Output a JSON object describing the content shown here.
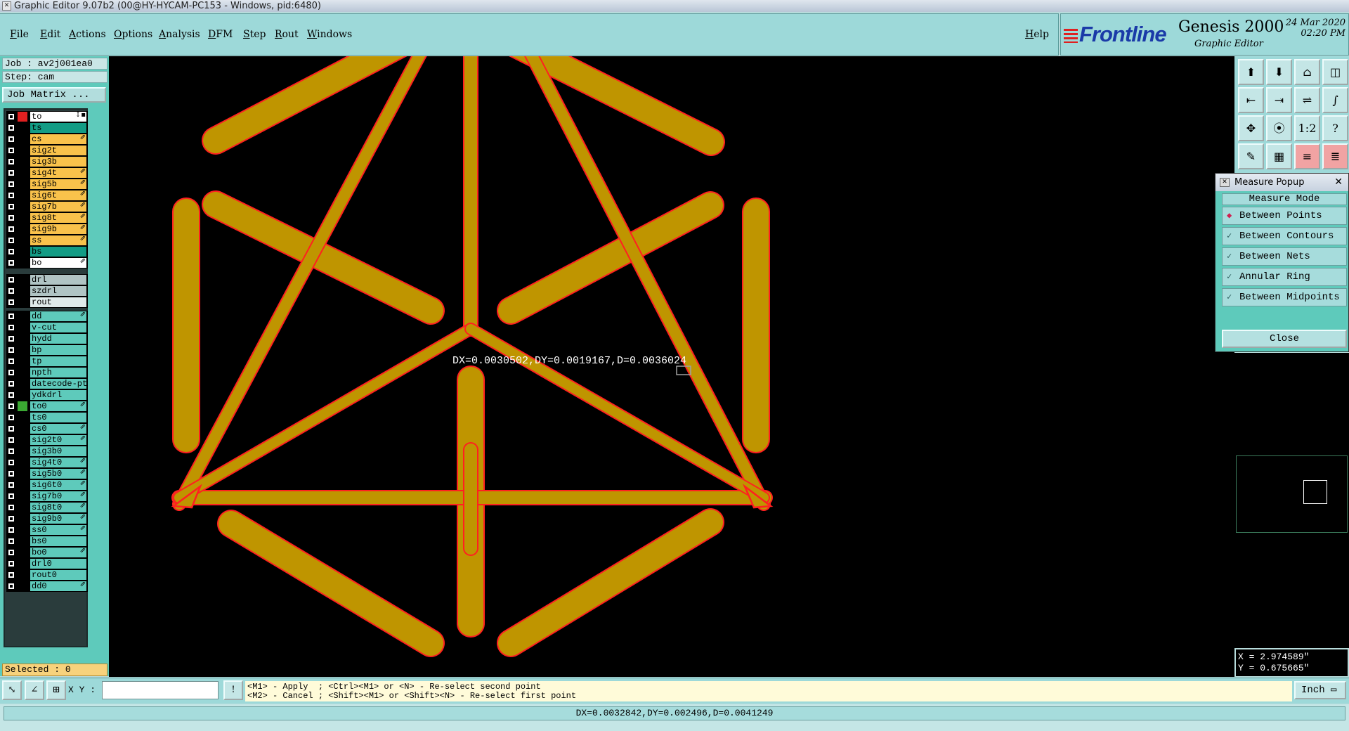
{
  "window": {
    "title": "Graphic Editor 9.07b2 (00@HY-HYCAM-PC153 - Windows, pid:6480)"
  },
  "menubar": {
    "items": [
      "File",
      "Edit",
      "Actions",
      "Options",
      "Analysis",
      "DFM",
      "Step",
      "Rout",
      "Windows"
    ],
    "help": "Help"
  },
  "brand": {
    "logo": "Frontline",
    "product": "Genesis 2000",
    "subtitle": "Graphic Editor",
    "date": "24 Mar 2020",
    "time": "02:20 PM"
  },
  "leftpanel": {
    "job": "Job : av2j001ea0",
    "step": "Step: cam",
    "job_matrix": "Job Matrix ...",
    "selected": "Selected : 0"
  },
  "layers": {
    "group1": [
      {
        "name": "to",
        "color": "#ffffff",
        "swatch": "#e02020",
        "mark": "↕▪"
      },
      {
        "name": "ts",
        "color": "#139c85",
        "swatch": "#000000",
        "mark": ""
      },
      {
        "name": "cs",
        "color": "#f9c24b",
        "swatch": "#000000",
        "mark": "⇗"
      },
      {
        "name": "sig2t",
        "color": "#f9c24b",
        "swatch": "#000000",
        "mark": ""
      },
      {
        "name": "sig3b",
        "color": "#f9c24b",
        "swatch": "#000000",
        "mark": ""
      },
      {
        "name": "sig4t",
        "color": "#f9c24b",
        "swatch": "#000000",
        "mark": "⇗"
      },
      {
        "name": "sig5b",
        "color": "#f9c24b",
        "swatch": "#000000",
        "mark": "⇗"
      },
      {
        "name": "sig6t",
        "color": "#f9c24b",
        "swatch": "#000000",
        "mark": "⇗"
      },
      {
        "name": "sig7b",
        "color": "#f9c24b",
        "swatch": "#000000",
        "mark": "⇗"
      },
      {
        "name": "sig8t",
        "color": "#f9c24b",
        "swatch": "#000000",
        "mark": "⇗"
      },
      {
        "name": "sig9b",
        "color": "#f9c24b",
        "swatch": "#000000",
        "mark": "⇗"
      },
      {
        "name": "ss",
        "color": "#f9c24b",
        "swatch": "#000000",
        "mark": "⇗"
      },
      {
        "name": "bs",
        "color": "#139c85",
        "swatch": "#000000",
        "mark": ""
      },
      {
        "name": "bo",
        "color": "#ffffff",
        "swatch": "#000000",
        "mark": "⇗"
      }
    ],
    "group2": [
      {
        "name": "drl",
        "color": "#b0c4c4",
        "swatch": "#000000",
        "mark": ""
      },
      {
        "name": "szdrl",
        "color": "#b0c4c4",
        "swatch": "#000000",
        "mark": ""
      },
      {
        "name": "rout",
        "color": "#e0eaea",
        "swatch": "#000000",
        "mark": ""
      }
    ],
    "group3": [
      {
        "name": "dd",
        "color": "#5ecabb",
        "swatch": "#000000",
        "mark": "⇗"
      },
      {
        "name": "v-cut",
        "color": "#5ecabb",
        "swatch": "#000000",
        "mark": ""
      },
      {
        "name": "hydd",
        "color": "#5ecabb",
        "swatch": "#000000",
        "mark": ""
      },
      {
        "name": "bp",
        "color": "#5ecabb",
        "swatch": "#000000",
        "mark": ""
      },
      {
        "name": "tp",
        "color": "#5ecabb",
        "swatch": "#000000",
        "mark": ""
      },
      {
        "name": "npth",
        "color": "#5ecabb",
        "swatch": "#000000",
        "mark": ""
      },
      {
        "name": "datecode-pt",
        "color": "#5ecabb",
        "swatch": "#000000",
        "mark": ""
      },
      {
        "name": "ydkdrl",
        "color": "#5ecabb",
        "swatch": "#000000",
        "mark": ""
      },
      {
        "name": "to0",
        "color": "#5ecabb",
        "swatch": "#3aa832",
        "mark": "⇗"
      },
      {
        "name": "ts0",
        "color": "#5ecabb",
        "swatch": "#000000",
        "mark": ""
      },
      {
        "name": "cs0",
        "color": "#5ecabb",
        "swatch": "#000000",
        "mark": "⇗"
      },
      {
        "name": "sig2t0",
        "color": "#5ecabb",
        "swatch": "#000000",
        "mark": "⇗"
      },
      {
        "name": "sig3b0",
        "color": "#5ecabb",
        "swatch": "#000000",
        "mark": ""
      },
      {
        "name": "sig4t0",
        "color": "#5ecabb",
        "swatch": "#000000",
        "mark": "⇗"
      },
      {
        "name": "sig5b0",
        "color": "#5ecabb",
        "swatch": "#000000",
        "mark": "⇗"
      },
      {
        "name": "sig6t0",
        "color": "#5ecabb",
        "swatch": "#000000",
        "mark": "⇗"
      },
      {
        "name": "sig7b0",
        "color": "#5ecabb",
        "swatch": "#000000",
        "mark": "⇗"
      },
      {
        "name": "sig8t0",
        "color": "#5ecabb",
        "swatch": "#000000",
        "mark": "⇗"
      },
      {
        "name": "sig9b0",
        "color": "#5ecabb",
        "swatch": "#000000",
        "mark": "⇗"
      },
      {
        "name": "ss0",
        "color": "#5ecabb",
        "swatch": "#000000",
        "mark": "⇗"
      },
      {
        "name": "bs0",
        "color": "#5ecabb",
        "swatch": "#000000",
        "mark": ""
      },
      {
        "name": "bo0",
        "color": "#5ecabb",
        "swatch": "#000000",
        "mark": "⇗"
      },
      {
        "name": "drl0",
        "color": "#5ecabb",
        "swatch": "#000000",
        "mark": ""
      },
      {
        "name": "rout0",
        "color": "#5ecabb",
        "swatch": "#000000",
        "mark": ""
      },
      {
        "name": "dd0",
        "color": "#5ecabb",
        "swatch": "#000000",
        "mark": "⇗"
      }
    ]
  },
  "canvas": {
    "measure_label": "DX=0.0030502,DY=0.0019167,D=0.0036024",
    "fill_color": "#bf9500",
    "outline_color": "#ff2020"
  },
  "toolbar": {
    "buttons": [
      {
        "name": "snap-up-icon",
        "glyph": "⬆"
      },
      {
        "name": "snap-down-icon",
        "glyph": "⬇"
      },
      {
        "name": "home-icon",
        "glyph": "⌂"
      },
      {
        "name": "window-icon",
        "glyph": "◫"
      },
      {
        "name": "left-icon",
        "glyph": "⇤"
      },
      {
        "name": "right-icon",
        "glyph": "⇥"
      },
      {
        "name": "mirror-icon",
        "glyph": "⇌"
      },
      {
        "name": "s-curve-icon",
        "glyph": "∫"
      },
      {
        "name": "fit-icon",
        "glyph": "✥"
      },
      {
        "name": "zoom-icon",
        "glyph": "⦿"
      },
      {
        "name": "scale-icon",
        "glyph": "1:2"
      },
      {
        "name": "help-icon",
        "glyph": "?"
      },
      {
        "name": "pen-icon",
        "glyph": "✎"
      },
      {
        "name": "grid-icon",
        "glyph": "▦"
      },
      {
        "name": "layer-a-icon",
        "glyph": "≡"
      },
      {
        "name": "layer-b-icon",
        "glyph": "≣"
      }
    ]
  },
  "popup": {
    "title": "Measure Popup",
    "mode_header": "Measure Mode",
    "items": [
      "Between Points",
      "Between Contours",
      "Between Nets",
      "Annular Ring",
      "Between Midpoints"
    ],
    "close": "Close"
  },
  "coords": {
    "x": "X = 2.974589\"",
    "y": "Y = 0.675665\""
  },
  "bottombar": {
    "xy_label": "X Y :",
    "xy_value": "",
    "hint_line1": "<M1> - Apply  ; <Ctrl><M1> or <N> - Re-select second point",
    "hint_line2": "<M2> - Cancel ; <Shift><M1> or <Shift><N> - Re-select first point",
    "units": "Inch"
  },
  "status": {
    "text": "DX=0.0032842,DY=0.002496,D=0.0041249"
  }
}
